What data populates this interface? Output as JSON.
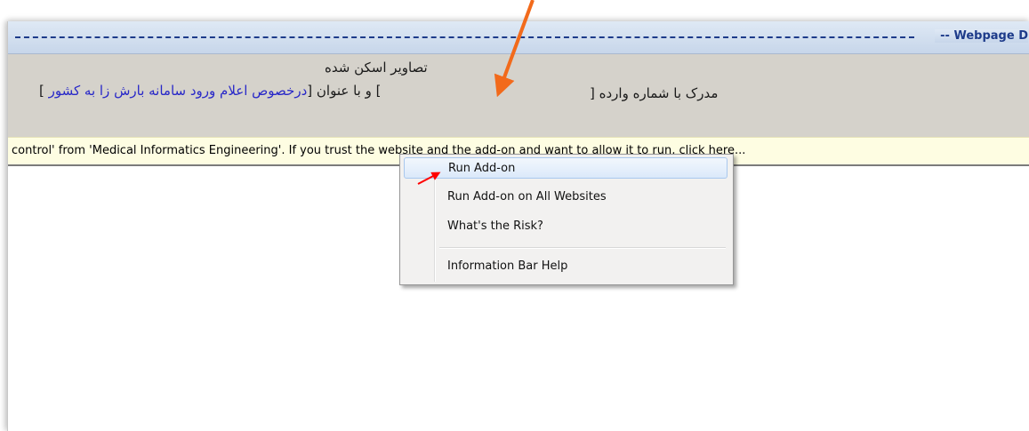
{
  "window": {
    "title": "-- Webpage D"
  },
  "content": {
    "scanned_images_title": "تصاویر اسکن شده",
    "doc_prefix": "[ ",
    "doc_subject_link": "درخصوص اعلام ورود سامانه بارش زا به کشور",
    "doc_subject_label": "] و با عنوان [",
    "doc_number_label": "مدرک با شماره وارده ["
  },
  "infobar": {
    "message": "control' from 'Medical Informatics Engineering'. If you trust the website and the add-on and want to allow it to run, click here..."
  },
  "context_menu": {
    "items": [
      {
        "label": "Run Add-on",
        "highlighted": true
      },
      {
        "label": "Run Add-on on All Websites"
      },
      {
        "label": "What's the Risk?"
      },
      {
        "label": "Information Bar Help"
      }
    ]
  },
  "colors": {
    "annotation_orange": "#f26a1b",
    "annotation_red": "#ff0000",
    "link_blue": "#2828c8",
    "infobar_bg": "#fefde2"
  }
}
